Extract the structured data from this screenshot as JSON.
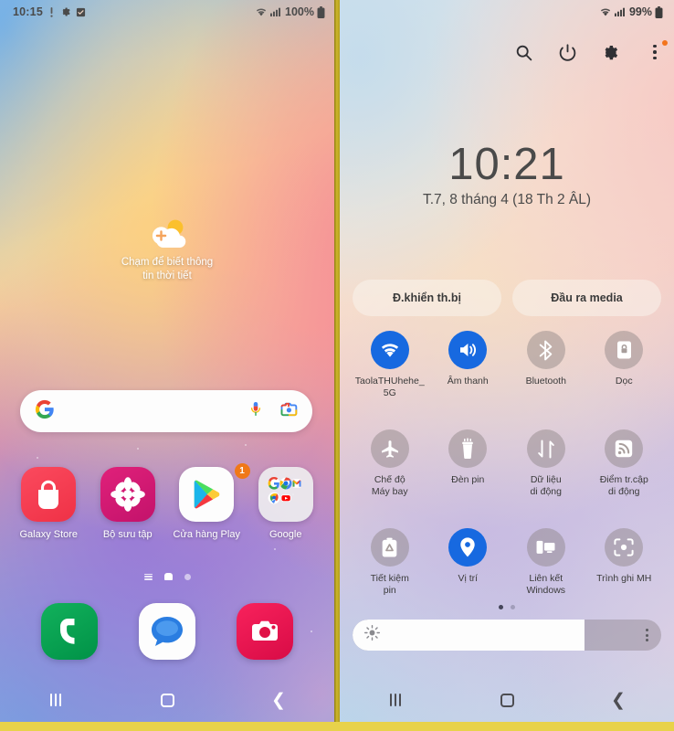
{
  "left_panel": {
    "statusbar": {
      "time": "10:15",
      "battery_pct": "100%",
      "icons": [
        "vibrate-icon",
        "gear-icon",
        "checkbox-icon",
        "wifi-icon",
        "signal-icon",
        "battery-icon"
      ]
    },
    "weather_widget": {
      "line1": "Chạm để biết thông",
      "line2": "tin thời tiết",
      "icon": "weather-add-icon"
    },
    "search": {
      "placeholder": "",
      "value": "",
      "google_icon": "google-g-icon",
      "mic_icon": "microphone-icon",
      "lens_icon": "google-lens-icon"
    },
    "apps": [
      {
        "label": "Galaxy Store",
        "icon": "galaxy-store-icon",
        "badge": ""
      },
      {
        "label": "Bộ sưu tập",
        "icon": "gallery-icon",
        "badge": ""
      },
      {
        "label": "Cửa hàng Play",
        "icon": "play-store-icon",
        "badge": "1"
      },
      {
        "label": "Google",
        "icon": "google-folder-icon",
        "badge": ""
      }
    ],
    "page_indicator": {
      "pages": 3,
      "active": 2
    },
    "dock": [
      {
        "label": "Phone",
        "icon": "phone-icon"
      },
      {
        "label": "Messages",
        "icon": "messages-icon"
      },
      {
        "label": "Camera",
        "icon": "camera-icon"
      }
    ],
    "navbar": {
      "recents": "recents-icon",
      "home": "home-icon",
      "back": "back-icon"
    }
  },
  "right_panel": {
    "statusbar": {
      "battery_pct": "99%"
    },
    "header_icons": [
      {
        "name": "search-icon",
        "badge": false
      },
      {
        "name": "power-icon",
        "badge": false
      },
      {
        "name": "gear-icon",
        "badge": false
      },
      {
        "name": "more-options-icon",
        "badge": true
      }
    ],
    "clock": {
      "time": "10:21",
      "date": "T.7, 8 tháng 4 (18 Th 2 ÂL)"
    },
    "pills": [
      {
        "label": "Đ.khiển th.bị"
      },
      {
        "label": "Đầu ra media"
      }
    ],
    "toggles": [
      {
        "label": "TaolaTHUhehe_\n5G",
        "line1": "TaolaTHUhehe_",
        "line2": "5G",
        "icon": "wifi-icon",
        "state": "on"
      },
      {
        "label": "Âm thanh",
        "line1": "Âm thanh",
        "line2": "",
        "icon": "sound-icon",
        "state": "on"
      },
      {
        "label": "Bluetooth",
        "line1": "Bluetooth",
        "line2": "",
        "icon": "bluetooth-icon",
        "state": "off"
      },
      {
        "label": "Dọc",
        "line1": "Dọc",
        "line2": "",
        "icon": "rotation-lock-icon",
        "state": "off"
      },
      {
        "label": "Chế độ Máy bay",
        "line1": "Chế độ",
        "line2": "Máy bay",
        "icon": "airplane-icon",
        "state": "off"
      },
      {
        "label": "Đèn pin",
        "line1": "Đèn pin",
        "line2": "",
        "icon": "flashlight-icon",
        "state": "off"
      },
      {
        "label": "Dữ liệu di động",
        "line1": "Dữ liệu",
        "line2": "di động",
        "icon": "mobile-data-icon",
        "state": "off"
      },
      {
        "label": "Điểm tr.cập di động",
        "line1": "Điểm tr.cập",
        "line2": "di động",
        "icon": "hotspot-icon",
        "state": "off"
      },
      {
        "label": "Tiết kiệm pin",
        "line1": "Tiết kiệm",
        "line2": "pin",
        "icon": "power-saving-icon",
        "state": "off"
      },
      {
        "label": "Vị trí",
        "line1": "Vị trí",
        "line2": "",
        "icon": "location-icon",
        "state": "on"
      },
      {
        "label": "Liên kết Windows",
        "line1": "Liên kết",
        "line2": "Windows",
        "icon": "link-to-windows-icon",
        "state": "off"
      },
      {
        "label": "Trình ghi MH",
        "line1": "Trình ghi MH",
        "line2": "",
        "icon": "screen-recorder-icon",
        "state": "off"
      }
    ],
    "page_dots": {
      "pages": 2,
      "active": 1
    },
    "brightness": {
      "value": 75,
      "sun_icon": "brightness-sun-icon",
      "menu_icon": "more-options-icon"
    },
    "navbar": {
      "recents": "recents-icon",
      "home": "home-icon",
      "back": "back-icon"
    }
  },
  "colors": {
    "accent_blue": "#1769e0",
    "badge_orange": "#f07818",
    "divider_olive": "#b9a22a",
    "toggle_off_gray": "rgba(140,130,130,.45)"
  }
}
